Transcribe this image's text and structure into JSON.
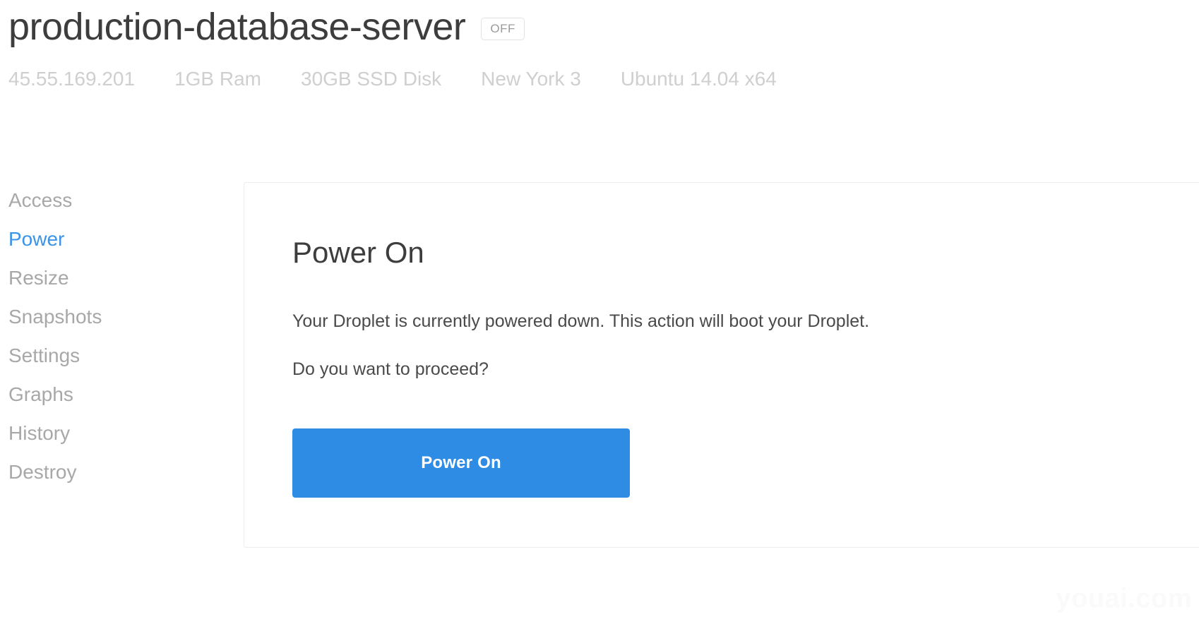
{
  "header": {
    "droplet_name": "production-database-server",
    "status_badge": "OFF",
    "meta": [
      {
        "label": "45.55.169.201"
      },
      {
        "label": "1GB Ram"
      },
      {
        "label": "30GB SSD Disk"
      },
      {
        "label": "New York 3"
      },
      {
        "label": "Ubuntu 14.04 x64"
      }
    ]
  },
  "sidebar": {
    "items": [
      {
        "label": "Access",
        "active": false
      },
      {
        "label": "Power",
        "active": true
      },
      {
        "label": "Resize",
        "active": false
      },
      {
        "label": "Snapshots",
        "active": false
      },
      {
        "label": "Settings",
        "active": false
      },
      {
        "label": "Graphs",
        "active": false
      },
      {
        "label": "History",
        "active": false
      },
      {
        "label": "Destroy",
        "active": false
      }
    ]
  },
  "main": {
    "card_title": "Power On",
    "paragraph_1": "Your Droplet is currently powered down. This action will boot your Droplet.",
    "paragraph_2": "Do you want to proceed?",
    "power_button_label": "Power On"
  },
  "watermark": {
    "text": "youai.com"
  },
  "colors": {
    "accent_blue": "#3b93e8",
    "button_blue": "#2e8ce5",
    "title_gray": "#3d3d3d",
    "meta_gray": "#cfcfcf",
    "nav_gray": "#a8a8a8",
    "card_border": "#ededed",
    "badge_gray": "#9b9b9b"
  }
}
